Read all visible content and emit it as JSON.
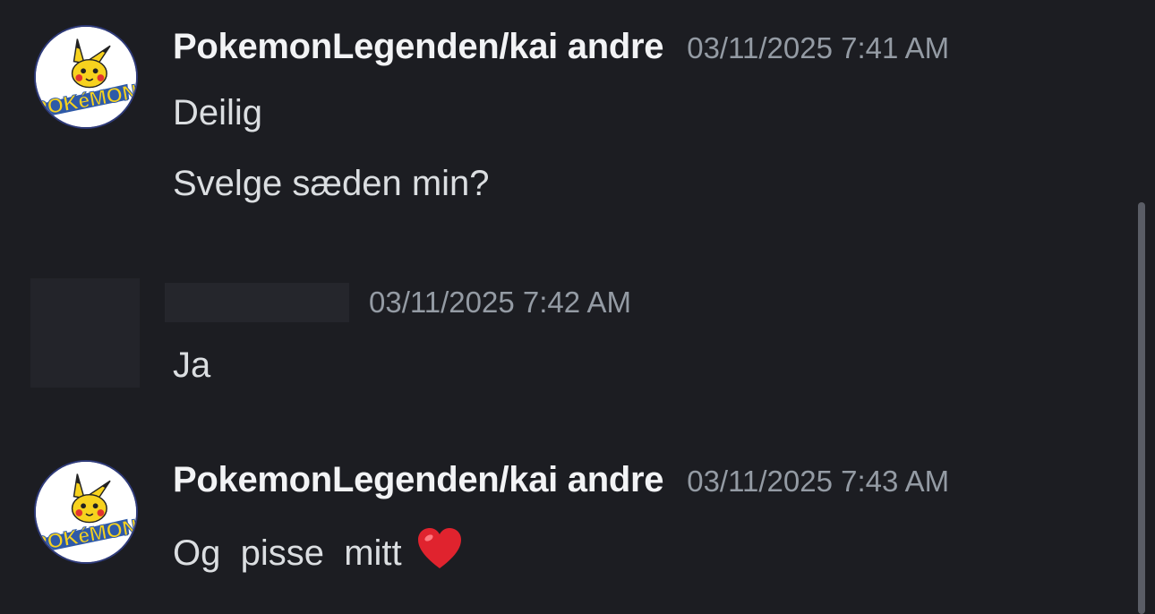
{
  "messages": [
    {
      "author": "PokemonLegenden/kai andre",
      "timestamp": "03/11/2025 7:41 AM",
      "lines": [
        "Deilig",
        "Svelge sæden min?"
      ],
      "avatar": "pokemon-pikachu-avatar"
    },
    {
      "author": "",
      "author_redacted": true,
      "timestamp": "03/11/2025 7:42 AM",
      "lines": [
        "Ja"
      ],
      "avatar": "redacted-avatar"
    },
    {
      "author": "PokemonLegenden/kai andre",
      "timestamp": "03/11/2025 7:43 AM",
      "lines": [
        "Og  pisse  mitt"
      ],
      "emoji": "red-heart-icon",
      "avatar": "pokemon-pikachu-avatar"
    }
  ],
  "colors": {
    "background": "#1c1d22",
    "username": "#f2f3f5",
    "timestamp": "#949ba4",
    "message_text": "#dbdee1",
    "heart": "#e0232e"
  }
}
